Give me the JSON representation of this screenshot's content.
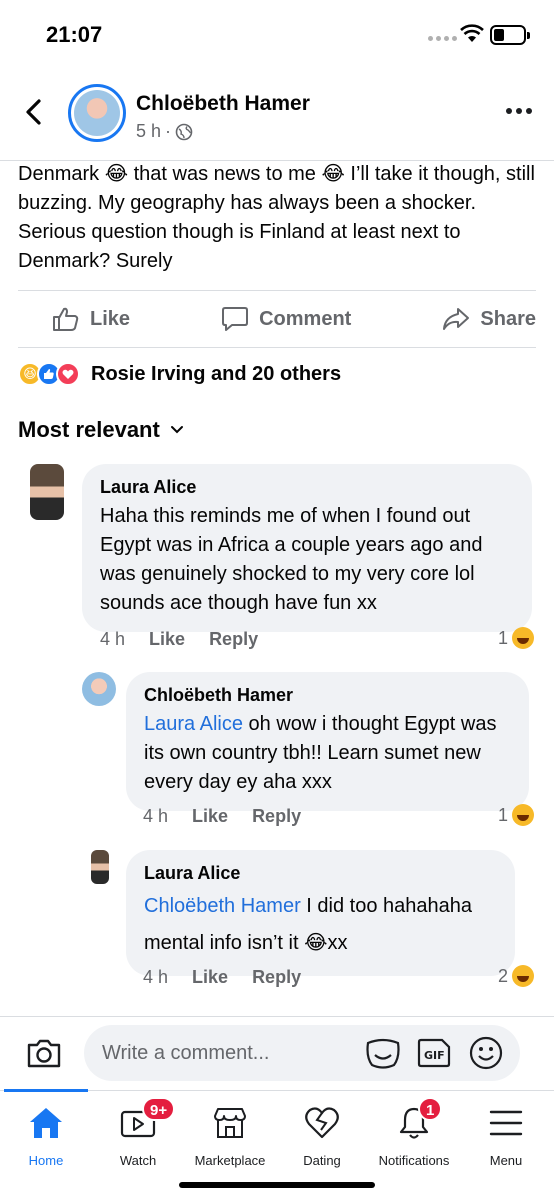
{
  "status_bar": {
    "time": "21:07"
  },
  "post": {
    "author": "Chloëbeth Hamer",
    "time": "5 h",
    "dot": "·",
    "text": "Denmark 😂 that was news to me 😂 I’ll take it though, still buzzing. My geography has always been a shocker. Serious question though is Finland at least next to Denmark? Surely"
  },
  "actions": {
    "like": "Like",
    "comment": "Comment",
    "share": "Share"
  },
  "reactions": {
    "summary": "Rosie Irving and 20 others",
    "icons": [
      "haha",
      "like",
      "love"
    ]
  },
  "sort": {
    "label": "Most relevant"
  },
  "comments": [
    {
      "name": "Laura Alice",
      "mention": "",
      "text": "Haha this reminds me of when I found out Egypt was in Africa a couple years ago and was genuinely shocked to my very core lol sounds ace though have fun xx",
      "time": "4 h",
      "like": "Like",
      "reply": "Reply",
      "reacts": "1"
    },
    {
      "name": "Chloëbeth Hamer",
      "mention": "Laura Alice",
      "text": " oh wow i thought Egypt was its own country tbh!! Learn sumet new every day ey aha xxx",
      "time": "4 h",
      "like": "Like",
      "reply": "Reply",
      "reacts": "1"
    },
    {
      "name": "Laura Alice",
      "mention": "Chloëbeth Hamer",
      "text": " I did too hahahaha mental info isn’t it 😂xx",
      "time": "4 h",
      "like": "Like",
      "reply": "Reply",
      "reacts": "2"
    }
  ],
  "composer": {
    "placeholder": "Write a comment..."
  },
  "tabs": [
    {
      "label": "Home",
      "badge": ""
    },
    {
      "label": "Watch",
      "badge": "9+"
    },
    {
      "label": "Marketplace",
      "badge": ""
    },
    {
      "label": "Dating",
      "badge": ""
    },
    {
      "label": "Notifications",
      "badge": "1"
    },
    {
      "label": "Menu",
      "badge": ""
    }
  ],
  "colors": {
    "accent": "#1877f2",
    "badge": "#e41e3f",
    "bubble": "#f0f2f5",
    "mention": "#216fdb"
  }
}
